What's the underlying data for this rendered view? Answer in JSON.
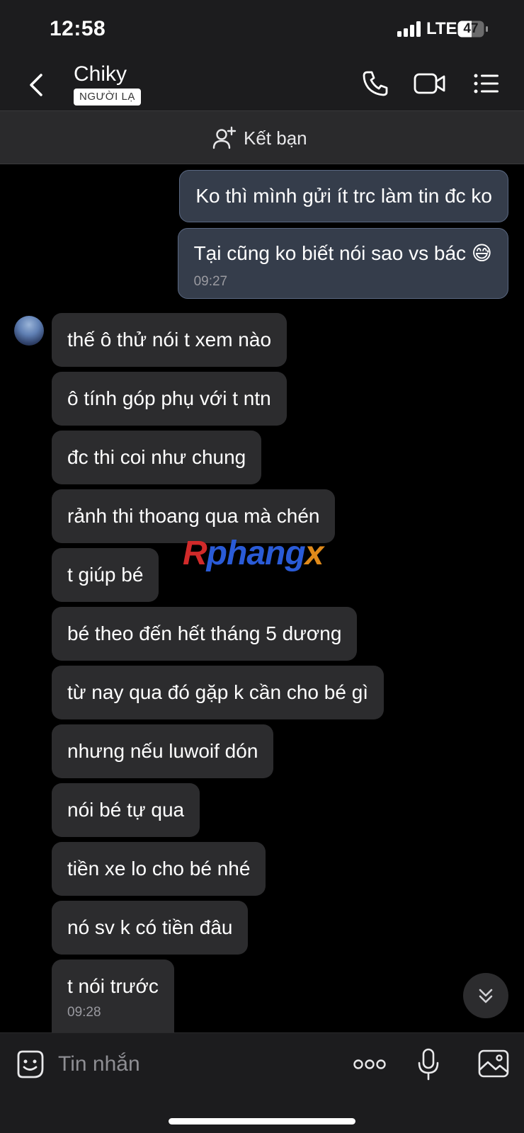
{
  "status_bar": {
    "time": "12:58",
    "network": "LTE",
    "battery": "47"
  },
  "header": {
    "contact_name": "Chiky",
    "badge": "NGƯỜI LẠ"
  },
  "friend_bar": {
    "label": "Kết bạn"
  },
  "messages_out": [
    {
      "text": "Ko thì mình gửi ít trc làm tin đc ko"
    },
    {
      "text": "Tại cũng ko biết nói sao vs bác 😅",
      "time": "09:27"
    }
  ],
  "messages_in": [
    "thế ô thử nói t xem nào",
    "ô tính góp phụ với t ntn",
    "đc thi coi như chung",
    "rảnh thi thoang qua mà chén",
    "t giúp bé",
    "bé theo đến hết tháng 5 dương",
    "từ nay qua đó gặp k cần cho bé gì",
    "nhưng nếu luwoif dón",
    "nói bé tự qua",
    "tiền xe lo cho bé nhé",
    "nó sv k có tiền đâu",
    "t nói trước"
  ],
  "last_in_time": "09:28",
  "watermark": {
    "r": "R",
    "phang": "phang",
    "x": "x"
  },
  "input": {
    "placeholder": "Tin nhắn"
  },
  "icons": {
    "back": "chevron-left-icon",
    "call": "phone-icon",
    "video": "video-camera-icon",
    "menu": "list-menu-icon",
    "add_friend": "add-user-icon",
    "sticker": "sticker-icon",
    "more": "more-dots-icon",
    "mic": "microphone-icon",
    "image": "image-icon",
    "scroll": "double-chevron-down-icon"
  },
  "colors": {
    "background": "#000000",
    "header": "#1c1c1e",
    "outgoing_bubble": "#353d4b",
    "incoming_bubble": "#2c2c2e"
  }
}
